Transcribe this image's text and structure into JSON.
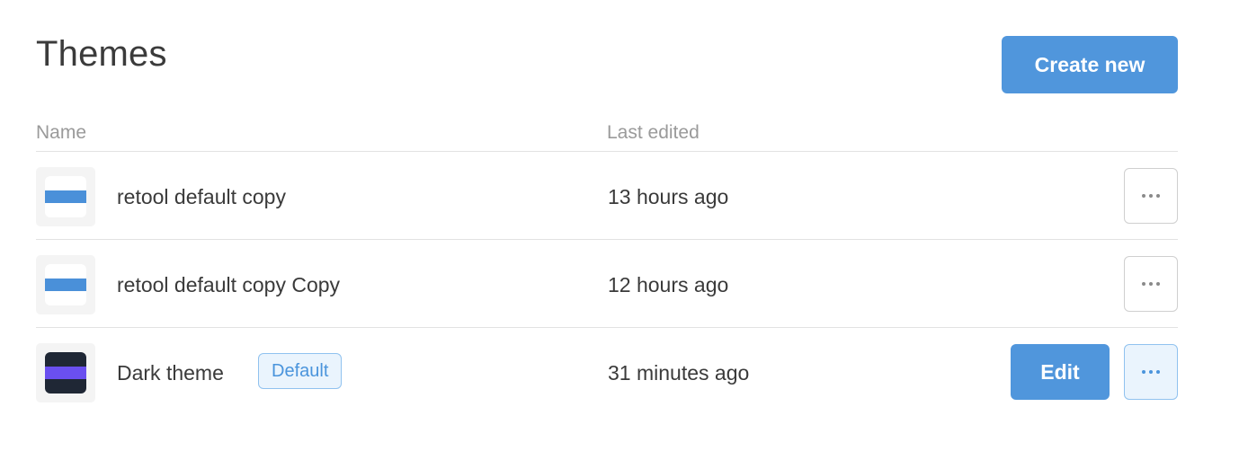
{
  "header": {
    "title": "Themes",
    "create_label": "Create new"
  },
  "table": {
    "columns": {
      "name": "Name",
      "last_edited": "Last edited"
    },
    "rows": [
      {
        "name": "retool default copy",
        "last_edited": "13 hours ago",
        "thumbnail": {
          "background": "#ffffff",
          "bar": "#4a90d9"
        }
      },
      {
        "name": "retool default copy Copy",
        "last_edited": "12 hours ago",
        "thumbnail": {
          "background": "#ffffff",
          "bar": "#4a90d9"
        }
      },
      {
        "name": "Dark theme",
        "badge": "Default",
        "last_edited": "31 minutes ago",
        "edit_label": "Edit",
        "thumbnail": {
          "background": "#1f2735",
          "bar": "#6a4ff0"
        }
      }
    ]
  },
  "colors": {
    "accent": "#5096dc",
    "badge_border": "#90c2ef",
    "badge_bg": "#eaf4fd"
  },
  "icons": {
    "more": "more-horizontal-icon"
  }
}
